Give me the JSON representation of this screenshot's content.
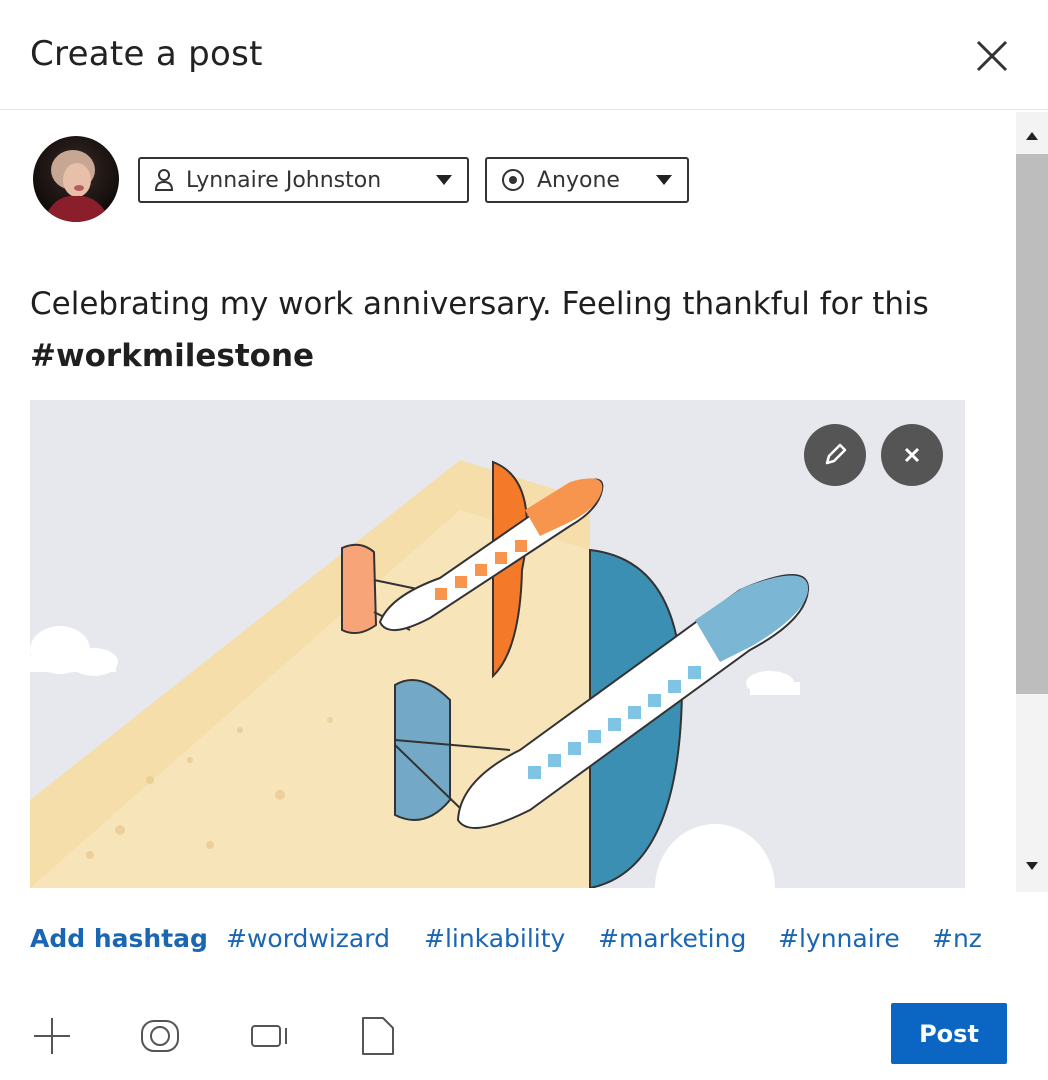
{
  "dialog": {
    "title": "Create a post",
    "close_icon": "close-icon"
  },
  "author": {
    "avatar_icon": "avatar",
    "name": "Lynnaire Johnston",
    "name_icon": "person-icon",
    "audience": "Anyone",
    "audience_icon": "globe-icon",
    "caret_icon": "caret-down-icon"
  },
  "post": {
    "text": "Celebrating my work anniversary. Feeling thankful for this",
    "hashtag": "#workmilestone"
  },
  "media": {
    "description_icon": "airplanes-illustration",
    "edit_icon": "pencil-icon",
    "remove_icon": "close-icon"
  },
  "hashtags": {
    "add_label": "Add hashtag",
    "suggestions": [
      "#wordwizard",
      "#linkability",
      "#marketing",
      "#lynnaire",
      "#nz"
    ]
  },
  "toolbar": {
    "icons": [
      "plus-icon",
      "camera-icon",
      "video-icon",
      "document-icon"
    ],
    "post_label": "Post"
  },
  "colors": {
    "accent": "#0a66c2",
    "hashtag": "#1a66b3",
    "orange_plane": "#f47a2a",
    "blue_plane": "#3b8fb3"
  }
}
